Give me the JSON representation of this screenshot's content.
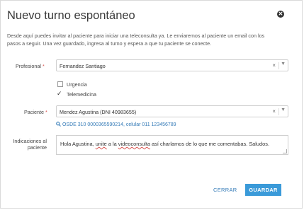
{
  "dialog": {
    "title": "Nuevo turno espontáneo",
    "description_line1": "Desde aquí puedes invitar al paciente para iniciar una teleconsulta ya. Le enviaremos al paciente un email con los",
    "description_line2": "pasos a seguir. Una vez guardado, ingresa al turno y espera a que tu paciente se conecte."
  },
  "form": {
    "profesional_label": "Profesional",
    "profesional_value": "Fernandez Santiago",
    "urgencia_label": "Urgencia",
    "urgencia_checked": false,
    "telemedicina_label": "Telemedicina",
    "telemedicina_checked": true,
    "paciente_label": "Paciente",
    "paciente_value": "Mendez Agustina (DNI 40983655)",
    "paciente_info": "OSDE 310 0000365590214, celular 011 123456789",
    "indicaciones_label_line1": "Indicaciones al",
    "indicaciones_label_line2": "paciente",
    "indicaciones_text_1": "Hola Agustina, ",
    "indicaciones_text_2": "unite",
    "indicaciones_text_3": " a la ",
    "indicaciones_text_4": "videoconsulta",
    "indicaciones_text_5": " así charlamos de lo que me comentabas. Saludos.",
    "required_mark": "*"
  },
  "buttons": {
    "cancel": "CERRAR",
    "save": "GUARDAR",
    "close_glyph": "✕",
    "clear_glyph": "×",
    "caret_glyph": "▼",
    "check_glyph": "✓",
    "search_glyph": "🔍"
  }
}
